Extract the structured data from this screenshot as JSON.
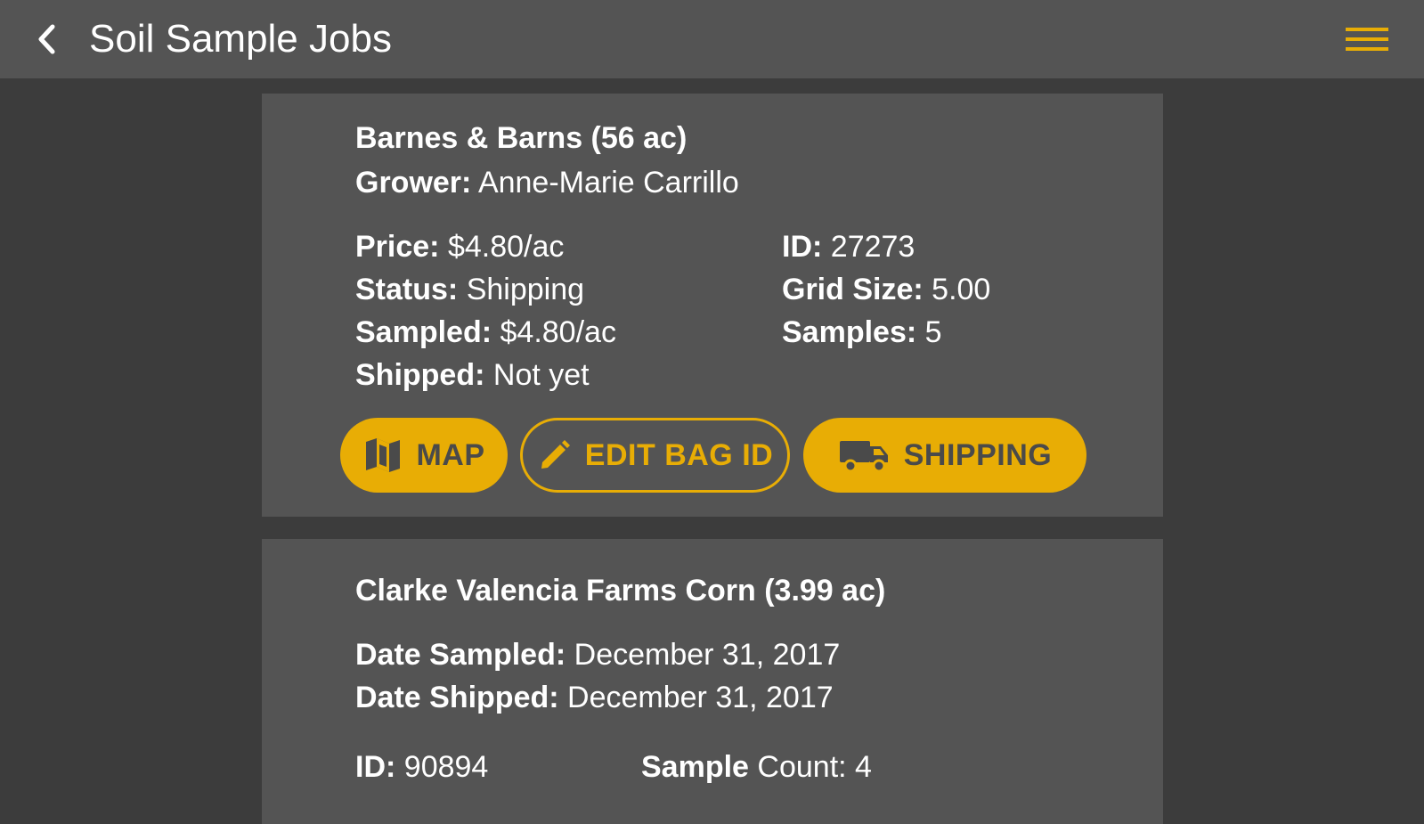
{
  "app": {
    "title": "Soil Sample Jobs",
    "accent_color": "#e8ad05",
    "back_icon": "chevron-left-icon",
    "menu_icon": "hamburger-menu-icon"
  },
  "jobs": [
    {
      "title": "Barnes & Barns  (56 ac)",
      "grower_label": "Grower:",
      "grower": "Anne-Marie Carrillo",
      "price_label": "Price:",
      "price": "$4.80/ac",
      "status_label": "Status:",
      "status": "Shipping",
      "sampled_label": "Sampled:",
      "sampled": "$4.80/ac",
      "shipped_label": "Shipped:",
      "shipped": "Not yet",
      "id_label": "ID:",
      "id": "27273",
      "grid_label": "Grid Size:",
      "grid": "5.00",
      "samples_label": "Samples:",
      "samples": "5",
      "buttons": {
        "map": "MAP",
        "edit": "EDIT BAG ID",
        "shipping": "SHIPPING"
      }
    },
    {
      "title": "Clarke Valencia Farms  Corn (3.99 ac)",
      "date_sampled_label": "Date Sampled:",
      "date_sampled": "December 31, 2017",
      "date_shipped_label": "Date Shipped:",
      "date_shipped": "December 31, 2017",
      "id_label": "ID:",
      "id": "90894",
      "sample_label": "Sample",
      "count_label": "Count:",
      "count": "4"
    }
  ]
}
